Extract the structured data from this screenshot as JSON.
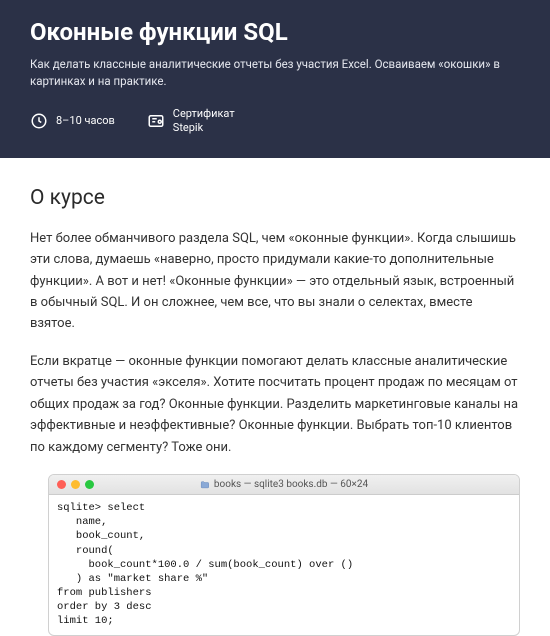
{
  "hero": {
    "title": "Оконные функции SQL",
    "subtitle": "Как делать классные аналитические отчеты без участия Excel. Осваиваем «окошки» в картинках и на практике.",
    "duration": "8–10 часов",
    "cert_line1": "Сертификат",
    "cert_line2": "Stepik"
  },
  "about": {
    "heading": "О курсе",
    "p1": "Нет более обманчивого раздела SQL, чем «оконные функции». Когда слышишь эти слова, думаешь «наверно, просто придумали какие-то дополнительные функции». А вот и нет! «Оконные функции» — это отдельный язык, встроенный в обычный SQL. И он сложнее, чем все, что вы знали о селектах, вместе взятое.",
    "p2": "Если вкратце — оконные функции помогают делать классные аналитические отчеты без участия «экселя». Хотите посчитать процент продаж по месяцам от общих продаж за год? Оконные функции. Разделить маркетинговые каналы на эффективные и неэффективные? Оконные функции. Выбрать топ-10 клиентов по каждому сегменту? Тоже они."
  },
  "terminal": {
    "title": "books — sqlite3 books.db — 60×24",
    "code": "sqlite> select\n   name,\n   book_count,\n   round(\n     book_count*100.0 / sum(book_count) over ()\n   ) as \"market share %\"\nfrom publishers\norder by 3 desc\nlimit 10;"
  }
}
